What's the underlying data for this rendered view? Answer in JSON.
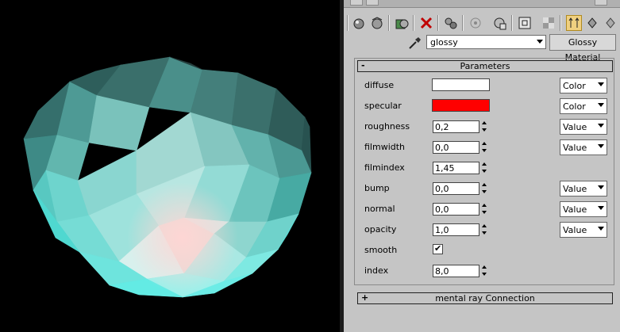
{
  "material": {
    "name": "glossy",
    "type_button": "Glossy Material"
  },
  "rollouts": {
    "parameters": {
      "sign": "-",
      "title": "Parameters"
    },
    "mental_ray": {
      "sign": "+",
      "title": "mental ray Connection"
    }
  },
  "parameters": [
    {
      "label": "diffuse",
      "kind": "color",
      "color": "#ffffff",
      "mode": "Color"
    },
    {
      "label": "specular",
      "kind": "color",
      "color": "#ff0000",
      "mode": "Color"
    },
    {
      "label": "roughness",
      "kind": "spin",
      "value": "0,2",
      "mode": "Value"
    },
    {
      "label": "filmwidth",
      "kind": "spin",
      "value": "0,0",
      "mode": "Value"
    },
    {
      "label": "filmindex",
      "kind": "spin",
      "value": "1,45"
    },
    {
      "label": "bump",
      "kind": "spin",
      "value": "0,0",
      "mode": "Value"
    },
    {
      "label": "normal",
      "kind": "spin",
      "value": "0,0",
      "mode": "Value"
    },
    {
      "label": "opacity",
      "kind": "spin",
      "value": "1,0",
      "mode": "Value"
    },
    {
      "label": "smooth",
      "kind": "check",
      "checked": "✔"
    },
    {
      "label": "index",
      "kind": "spin",
      "value": "8,0"
    }
  ],
  "toolbar_icons": [
    "get-material-icon",
    "put-to-scene-icon",
    "assign-material-icon",
    "delete-icon",
    "make-unique-icon",
    "put-to-library-icon",
    "material-effects-icon",
    "show-map-icon",
    "show-end-result-icon",
    "go-to-parent-icon",
    "go-forward-icon"
  ],
  "colors": {
    "panel_bg": "#c5c5c5",
    "viewport_bg": "#000000",
    "object": "#5ed8d2",
    "highlight": "#ffd6d4"
  }
}
